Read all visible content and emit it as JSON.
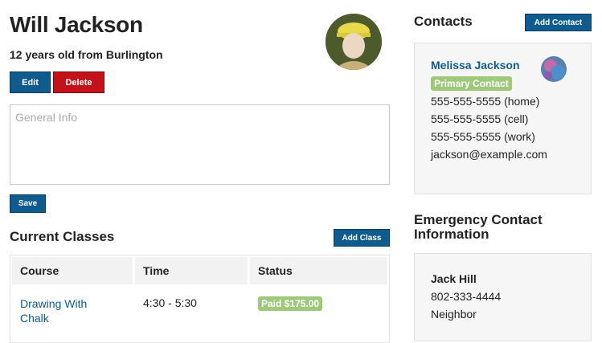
{
  "student": {
    "name": "Will Jackson",
    "subtitle": "12 years old from Burlington",
    "edit_label": "Edit",
    "delete_label": "Delete",
    "info_placeholder": "General Info",
    "save_label": "Save"
  },
  "classes": {
    "heading": "Current Classes",
    "add_label": "Add Class",
    "columns": [
      "Course",
      "Time",
      "Status"
    ],
    "rows": [
      {
        "course": "Drawing With Chalk",
        "time": "4:30 - 5:30",
        "status": "Paid $175.00"
      }
    ]
  },
  "contacts": {
    "heading": "Contacts",
    "add_label": "Add Contact",
    "primary": {
      "name": "Melissa Jackson",
      "badge": "Primary Contact",
      "phone_home": "555-555-5555 (home)",
      "phone_cell": "555-555-5555 (cell)",
      "phone_work": "555-555-5555 (work)",
      "email": "jackson@example.com"
    }
  },
  "emergency": {
    "heading_line1": "Emergency Contact",
    "heading_line2": "Information",
    "name": "Jack Hill",
    "phone": "802-333-4444",
    "relation": "Neighbor"
  },
  "colors": {
    "primary_blue": "#0f5b8e",
    "danger_red": "#c4121b",
    "badge_green": "#9ec97d"
  }
}
